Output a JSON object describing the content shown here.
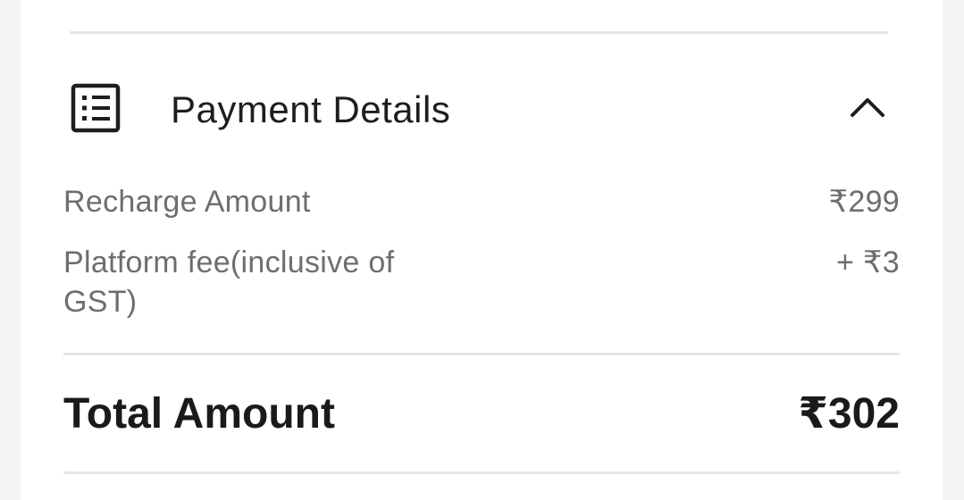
{
  "payment_details": {
    "title": "Payment Details",
    "icon": "receipt-list-icon",
    "toggle_icon": "chevron-up-icon",
    "expanded": true,
    "items": [
      {
        "label": "Recharge Amount",
        "value": "₹299"
      },
      {
        "label": "Platform fee(inclusive of GST)",
        "value": "+ ₹3"
      }
    ],
    "total": {
      "label": "Total Amount",
      "value": "₹302"
    }
  },
  "colors": {
    "background": "#f5f5f5",
    "card": "#ffffff",
    "divider": "#e6e6e6",
    "title_text": "#1e1e1e",
    "secondary_text": "#6e6e6e",
    "total_text": "#1a1a1a"
  }
}
